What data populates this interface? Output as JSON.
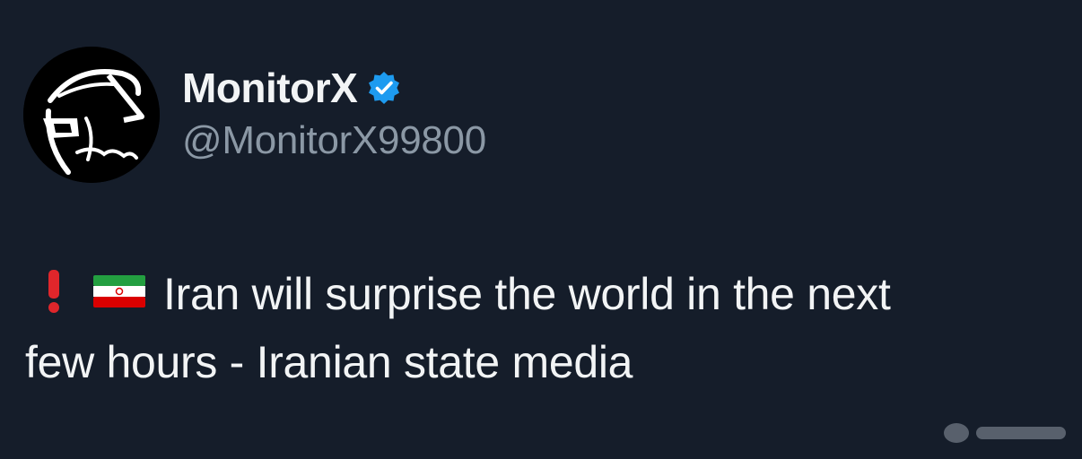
{
  "author": {
    "display_name": "MonitorX",
    "verified": true,
    "handle": "@MonitorX99800"
  },
  "tweet": {
    "emoji_prefix": [
      "exclamation-mark",
      "iran-flag"
    ],
    "text_line1": "Iran will surprise the world in the next",
    "text_line2": "few hours - Iranian state media"
  },
  "colors": {
    "background": "#151d2a",
    "text_primary": "#f2f4f5",
    "text_secondary": "#8b98a5",
    "verified_badge": "#1d9bf0",
    "exclamation": "#e0262b"
  }
}
